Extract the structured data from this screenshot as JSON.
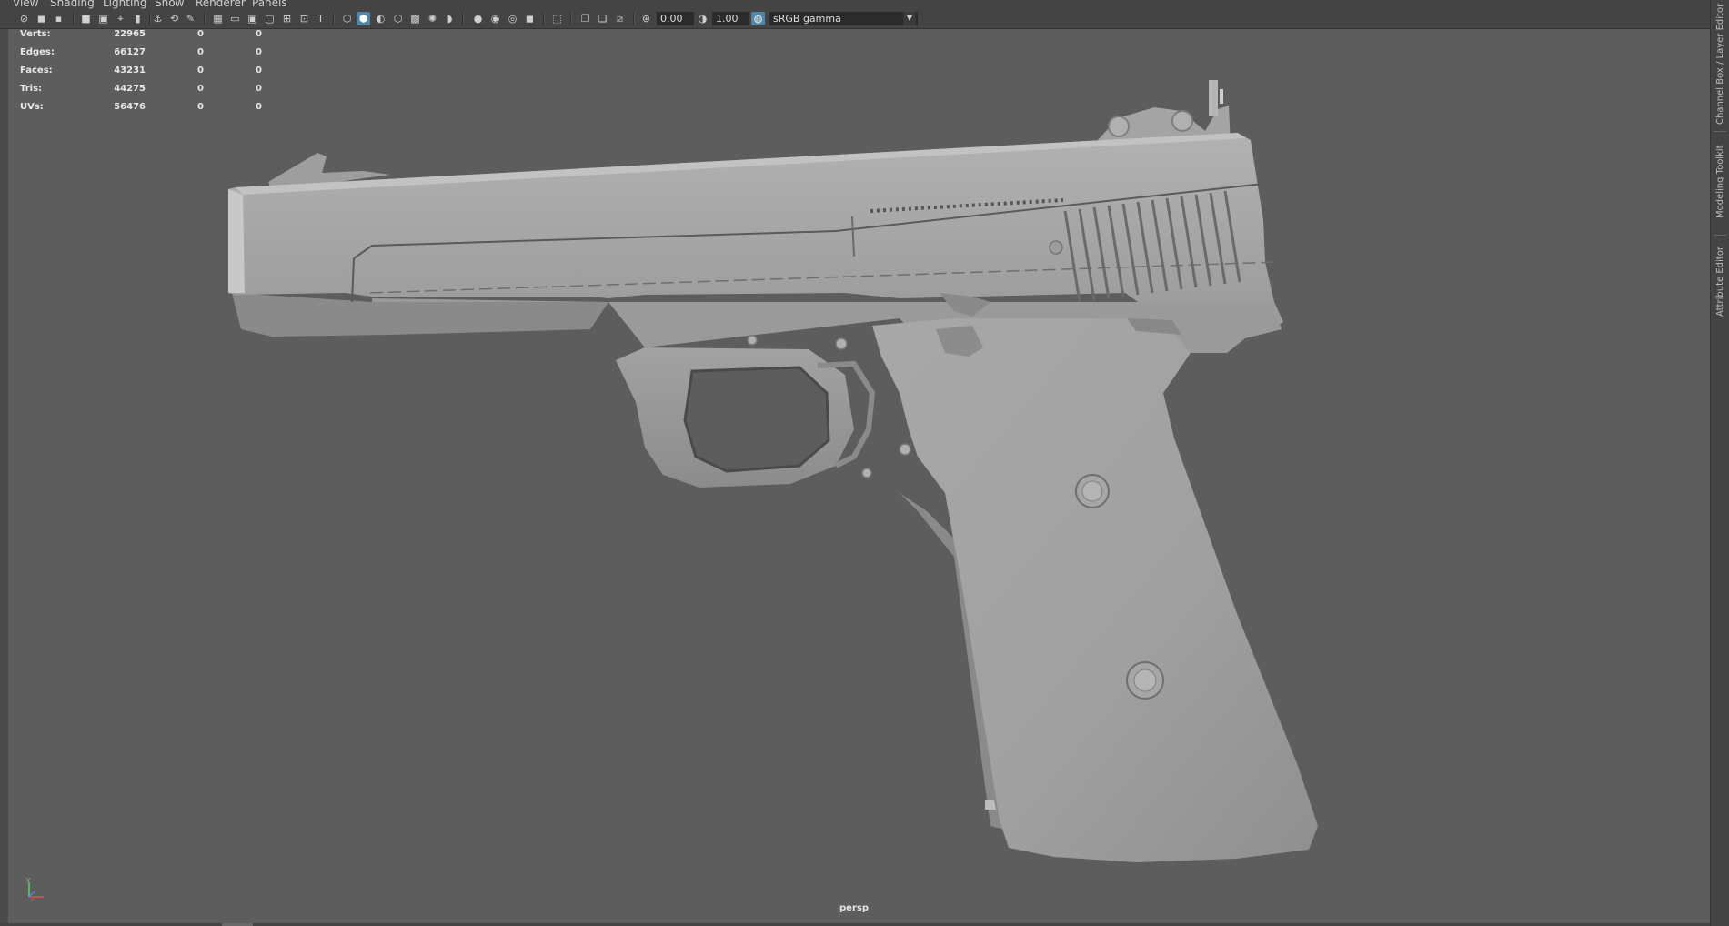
{
  "menu": {
    "items": [
      "View",
      "Shading",
      "Lighting",
      "Show",
      "Renderer",
      "Panels"
    ]
  },
  "toolbar": {
    "exposure_value": "0.00",
    "gamma_value": "1.00",
    "colorspace": "sRGB gamma"
  },
  "hud": {
    "rows": [
      {
        "label": "Verts:",
        "v1": "22965",
        "v2": "0",
        "v3": "0"
      },
      {
        "label": "Edges:",
        "v1": "66127",
        "v2": "0",
        "v3": "0"
      },
      {
        "label": "Faces:",
        "v1": "43231",
        "v2": "0",
        "v3": "0"
      },
      {
        "label": "Tris:",
        "v1": "44275",
        "v2": "0",
        "v3": "0"
      },
      {
        "label": "UVs:",
        "v1": "56476",
        "v2": "0",
        "v3": "0"
      }
    ]
  },
  "viewport": {
    "camera": "persp",
    "background_color": "#5d5d5d",
    "model_color": "#a6a6a6"
  },
  "right_panel": {
    "tabs": [
      "Channel Box / Layer Editor",
      "Modeling Toolkit",
      "Attribute Editor"
    ]
  },
  "colors": {
    "accent": "#5285a6",
    "panel": "#444444"
  }
}
